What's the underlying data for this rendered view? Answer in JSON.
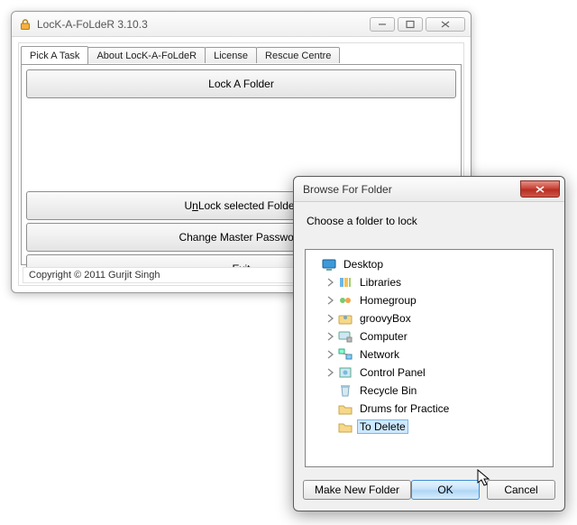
{
  "app": {
    "title": "LocK-A-FoLdeR 3.10.3",
    "copyright": "Copyright © 2011 Gurjit Singh"
  },
  "tabs": {
    "pick": "Pick A Task",
    "about": "About LocK-A-FoLdeR",
    "license": "License",
    "rescue": "Rescue Centre"
  },
  "buttons": {
    "lock": "Lock A Folder",
    "unlock_prefix": "U",
    "unlock_ul": "n",
    "unlock_suffix": "Lock selected Folder",
    "cmp": "Change Master Password",
    "exit_ul": "E",
    "exit_suffix": "xit"
  },
  "dialog": {
    "title": "Browse For Folder",
    "prompt": "Choose a folder to lock",
    "make_new": "Make New Folder",
    "ok": "OK",
    "cancel": "Cancel"
  },
  "tree": {
    "desktop": "Desktop",
    "libraries": "Libraries",
    "homegroup": "Homegroup",
    "groovybox": "groovyBox",
    "computer": "Computer",
    "network": "Network",
    "controlpanel": "Control Panel",
    "recyclebin": "Recycle Bin",
    "drums": "Drums for Practice",
    "todelete": "To Delete"
  }
}
